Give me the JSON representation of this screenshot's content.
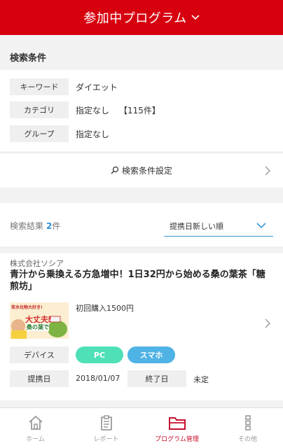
{
  "header": {
    "title": "参加中プログラム"
  },
  "conditions": {
    "section_title": "検索条件",
    "rows": [
      {
        "label": "キーワード",
        "value": "ダイエット"
      },
      {
        "label": "カテゴリ",
        "value": "指定なし",
        "count": "【115件】"
      },
      {
        "label": "グループ",
        "value": "指定なし"
      }
    ],
    "settings_label": "検索条件設定"
  },
  "results": {
    "label": "検索結果",
    "count": "2",
    "unit": "件",
    "sort_selected": "提携日新しい順"
  },
  "program": {
    "company": "株式会社ソシア",
    "title": "青汁から乗換える方急増中！1日32円から始める桑の葉茶「糖煎坊」",
    "reward": "初回購入1500円",
    "device_label": "デバイス",
    "devices": [
      "PC",
      "スマホ"
    ],
    "start_label": "提携日",
    "start_date": "2018/01/07",
    "end_label": "終了日",
    "end_value": "未定",
    "thumbnail_text": {
      "top": "炭水化物大好き!",
      "mid": "大丈夫!",
      "bottom": "桑の葉で"
    }
  },
  "tabbar": {
    "items": [
      {
        "label": "ホーム",
        "icon": "home-icon"
      },
      {
        "label": "レポート",
        "icon": "clipboard-icon"
      },
      {
        "label": "プログラム管理",
        "icon": "folder-icon",
        "active": true
      },
      {
        "label": "その他",
        "icon": "more-icon"
      }
    ]
  },
  "colors": {
    "brand": "#d7000f",
    "pc": "#4fe0b8",
    "smartphone": "#4fb3e6",
    "link": "#2a8fd6"
  }
}
